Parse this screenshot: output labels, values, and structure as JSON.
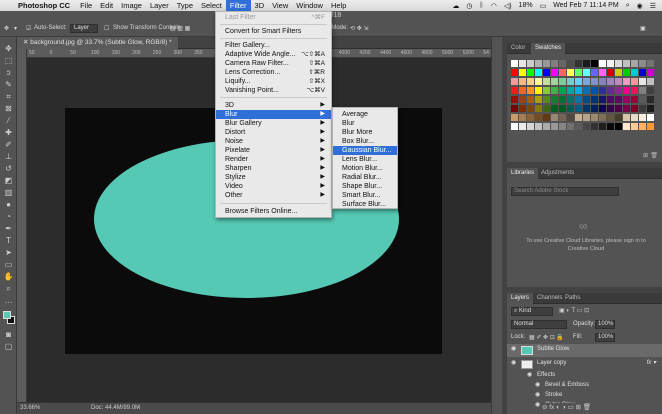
{
  "menubar": {
    "apple": "",
    "app_name": "Photoshop CC",
    "items": [
      "File",
      "Edit",
      "Image",
      "Layer",
      "Type",
      "Select",
      "Filter",
      "3D",
      "View",
      "Window",
      "Help"
    ],
    "active_item": "Filter",
    "battery": "18%",
    "clock": "Wed Feb 7  11:14 PM"
  },
  "app_title": "hop CC 2018",
  "options_bar": {
    "auto_select_label": "Auto-Select:",
    "auto_select_value": "Layer",
    "transform_label": "Show Transform Controls",
    "mode_3d": "3D Mode:"
  },
  "document": {
    "tab_title": "background.jpg @ 33.7% (Subtle Glow, RGB/8) *",
    "ruler_ticks": [
      "50",
      "0",
      "50",
      "100",
      "150",
      "200",
      "250",
      "300",
      "350",
      "400",
      "450",
      "500",
      "550",
      "600",
      "3800",
      "4000",
      "4200",
      "4400",
      "4600",
      "4800",
      "5000",
      "5200",
      "54"
    ]
  },
  "status": {
    "zoom": "33.66%",
    "doc": "Doc: 44.4M/89.0M"
  },
  "filter_menu": {
    "last_filter": "Last Filter",
    "last_filter_shortcut": "^⌘F",
    "convert": "Convert for Smart Filters",
    "items": [
      {
        "label": "Filter Gallery...",
        "shortcut": ""
      },
      {
        "label": "Adaptive Wide Angle...",
        "shortcut": "⌥⇧⌘A"
      },
      {
        "label": "Camera Raw Filter...",
        "shortcut": "⇧⌘A"
      },
      {
        "label": "Lens Correction...",
        "shortcut": "⇧⌘R"
      },
      {
        "label": "Liquify...",
        "shortcut": "⇧⌘X"
      },
      {
        "label": "Vanishing Point...",
        "shortcut": "⌥⌘V"
      }
    ],
    "submenus": [
      "3D",
      "Blur",
      "Blur Gallery",
      "Distort",
      "Noise",
      "Pixelate",
      "Render",
      "Sharpen",
      "Stylize",
      "Video",
      "Other"
    ],
    "highlighted": "Blur",
    "browse": "Browse Filters Online..."
  },
  "blur_submenu": {
    "items": [
      "Average",
      "Blur",
      "Blur More",
      "Box Blur...",
      "Gaussian Blur...",
      "Lens Blur...",
      "Motion Blur...",
      "Radial Blur...",
      "Shape Blur...",
      "Smart Blur...",
      "Surface Blur..."
    ],
    "highlighted": "Gaussian Blur..."
  },
  "color_panel": {
    "tabs": [
      "Color",
      "Swatches"
    ],
    "active": "Swatches"
  },
  "libraries_panel": {
    "tabs": [
      "Libraries",
      "Adjustments"
    ],
    "search_placeholder": "Search Adobe Stock",
    "message": "To use Creative Cloud Libraries, please sign in to Creative Cloud"
  },
  "layers_panel": {
    "tabs": [
      "Layers",
      "Channels",
      "Paths"
    ],
    "kind": "Kind",
    "blend_mode": "Normal",
    "opacity_label": "Opacity:",
    "opacity": "100%",
    "lock_label": "Lock:",
    "fill_label": "Fill:",
    "fill": "100%",
    "layers": [
      {
        "name": "Subtle Glow",
        "selected": true,
        "fx": false
      },
      {
        "name": "Layer copy",
        "selected": false,
        "fx": true
      }
    ],
    "effects_label": "Effects",
    "effects": [
      "Bevel & Emboss",
      "Stroke",
      "Outer Glow"
    ]
  },
  "colors": {
    "accent": "#2f6fd8",
    "canvas_shape": "#56c9b5",
    "canvas_bg": "#0b0b0b"
  }
}
